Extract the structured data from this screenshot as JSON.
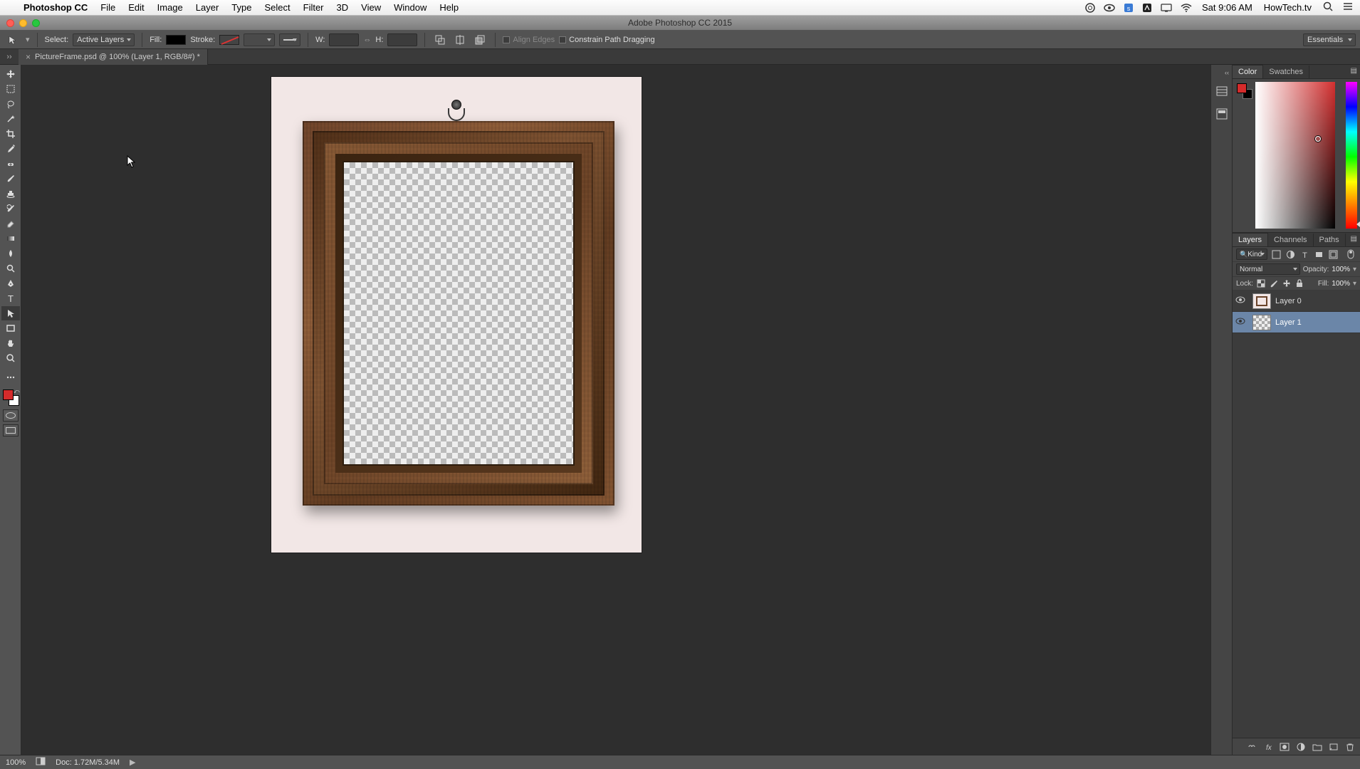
{
  "mac_menu": {
    "app": "Photoshop CC",
    "items": [
      "File",
      "Edit",
      "Image",
      "Layer",
      "Type",
      "Select",
      "Filter",
      "3D",
      "View",
      "Window",
      "Help"
    ],
    "clock": "Sat 9:06 AM",
    "site": "HowTech.tv"
  },
  "window": {
    "title": "Adobe Photoshop CC 2015"
  },
  "options": {
    "select_label": "Select:",
    "select_value": "Active Layers",
    "fill_label": "Fill:",
    "stroke_label": "Stroke:",
    "w_label": "W:",
    "h_label": "H:",
    "align_edges": "Align Edges",
    "constrain": "Constrain Path Dragging",
    "workspace": "Essentials"
  },
  "doc": {
    "tab": "PictureFrame.psd @ 100% (Layer 1, RGB/8#) *"
  },
  "panels": {
    "color_tab": "Color",
    "swatches_tab": "Swatches",
    "layers_tab": "Layers",
    "channels_tab": "Channels",
    "paths_tab": "Paths"
  },
  "layers": {
    "kind": "Kind",
    "blend": "Normal",
    "opacity_label": "Opacity:",
    "opacity_val": "100%",
    "lock_label": "Lock:",
    "fill_label": "Fill:",
    "fill_val": "100%",
    "items": [
      {
        "name": "Layer 0"
      },
      {
        "name": "Layer 1"
      }
    ]
  },
  "status": {
    "zoom": "100%",
    "doc": "Doc: 1.72M/5.34M"
  }
}
